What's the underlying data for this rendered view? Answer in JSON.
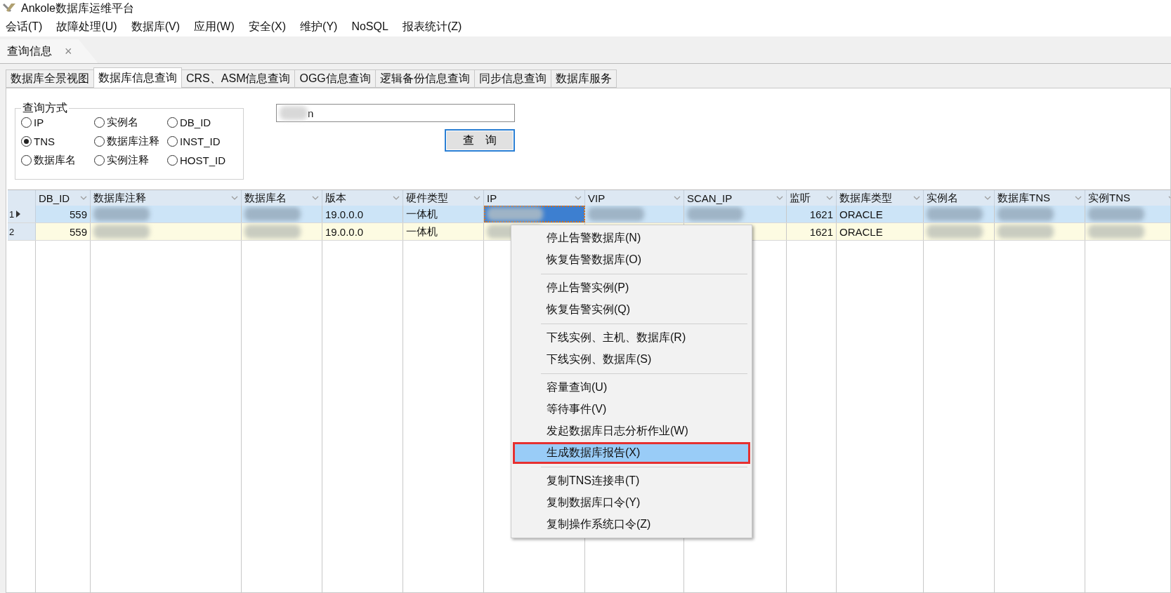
{
  "window": {
    "title": "Ankole数据库运维平台"
  },
  "menubar": [
    "会话(T)",
    "故障处理(U)",
    "数据库(V)",
    "应用(W)",
    "安全(X)",
    "维护(Y)",
    "NoSQL",
    "报表统计(Z)"
  ],
  "document_tab": {
    "label": "查询信息",
    "close": "×"
  },
  "tabs": [
    {
      "label": "数据库全景视图",
      "selected": false
    },
    {
      "label": "数据库信息查询",
      "selected": true
    },
    {
      "label": "CRS、ASM信息查询",
      "selected": false
    },
    {
      "label": "OGG信息查询",
      "selected": false
    },
    {
      "label": "逻辑备份信息查询",
      "selected": false
    },
    {
      "label": "同步信息查询",
      "selected": false
    },
    {
      "label": "数据库服务",
      "selected": false
    }
  ],
  "query_mode": {
    "title": "查询方式",
    "options": [
      {
        "label": "IP",
        "selected": false
      },
      {
        "label": "实例名",
        "selected": false
      },
      {
        "label": "DB_ID",
        "selected": false
      },
      {
        "label": "TNS",
        "selected": true
      },
      {
        "label": "数据库注释",
        "selected": false
      },
      {
        "label": "INST_ID",
        "selected": false
      },
      {
        "label": "数据库名",
        "selected": false
      },
      {
        "label": "实例注释",
        "selected": false
      },
      {
        "label": "HOST_ID",
        "selected": false
      }
    ]
  },
  "search": {
    "value": "n",
    "blurred": true
  },
  "query_button": "查　询",
  "table": {
    "columns": [
      {
        "label": "DB_ID",
        "kind": "number"
      },
      {
        "label": "数据库注释",
        "kind": "text"
      },
      {
        "label": "数据库名",
        "kind": "text"
      },
      {
        "label": "版本",
        "kind": "text"
      },
      {
        "label": "硬件类型",
        "kind": "text"
      },
      {
        "label": "IP",
        "kind": "text"
      },
      {
        "label": "VIP",
        "kind": "text"
      },
      {
        "label": "SCAN_IP",
        "kind": "text"
      },
      {
        "label": "监听",
        "kind": "number"
      },
      {
        "label": "数据库类型",
        "kind": "text"
      },
      {
        "label": "实例名",
        "kind": "text"
      },
      {
        "label": "数据库TNS",
        "kind": "text"
      },
      {
        "label": "实例TNS",
        "kind": "text"
      }
    ],
    "rows": [
      {
        "number": "1",
        "current": true,
        "selected": true,
        "cells": [
          {
            "text": "559"
          },
          {
            "blurred": true
          },
          {
            "blurred": true
          },
          {
            "text": "19.0.0.0"
          },
          {
            "text": "一体机"
          },
          {
            "blurred": true,
            "focused": true
          },
          {
            "blurred": true
          },
          {
            "blurred": true
          },
          {
            "text": "1621"
          },
          {
            "text": "ORACLE"
          },
          {
            "blurred": true
          },
          {
            "blurred": true
          },
          {
            "blurred": true
          }
        ]
      },
      {
        "number": "2",
        "current": false,
        "selected": false,
        "cells": [
          {
            "text": "559"
          },
          {
            "blurred": true
          },
          {
            "blurred": true
          },
          {
            "text": "19.0.0.0"
          },
          {
            "text": "一体机"
          },
          {
            "blurred": true
          },
          {},
          {},
          {
            "text": "1621"
          },
          {
            "text": "ORACLE"
          },
          {
            "blurred": true
          },
          {
            "blurred": true
          },
          {
            "blurred": true
          }
        ]
      }
    ]
  },
  "context_menu": {
    "groups": [
      [
        {
          "label": "停止告警数据库(N)",
          "selected": false,
          "annotated": false
        },
        {
          "label": "恢复告警数据库(O)",
          "selected": false,
          "annotated": false
        }
      ],
      [
        {
          "label": "停止告警实例(P)",
          "selected": false,
          "annotated": false
        },
        {
          "label": "恢复告警实例(Q)",
          "selected": false,
          "annotated": false
        }
      ],
      [
        {
          "label": "下线实例、主机、数据库(R)",
          "selected": false,
          "annotated": false
        },
        {
          "label": "下线实例、数据库(S)",
          "selected": false,
          "annotated": false
        }
      ],
      [
        {
          "label": "容量查询(U)",
          "selected": false,
          "annotated": false
        },
        {
          "label": "等待事件(V)",
          "selected": false,
          "annotated": false
        },
        {
          "label": "发起数据库日志分析作业(W)",
          "selected": false,
          "annotated": false
        },
        {
          "label": "生成数据库报告(X)",
          "selected": true,
          "annotated": true
        }
      ],
      [
        {
          "label": "复制TNS连接串(T)",
          "selected": false,
          "annotated": false
        },
        {
          "label": "复制数据库口令(Y)",
          "selected": false,
          "annotated": false
        },
        {
          "label": "复制操作系统口令(Z)",
          "selected": false,
          "annotated": false
        }
      ]
    ]
  }
}
